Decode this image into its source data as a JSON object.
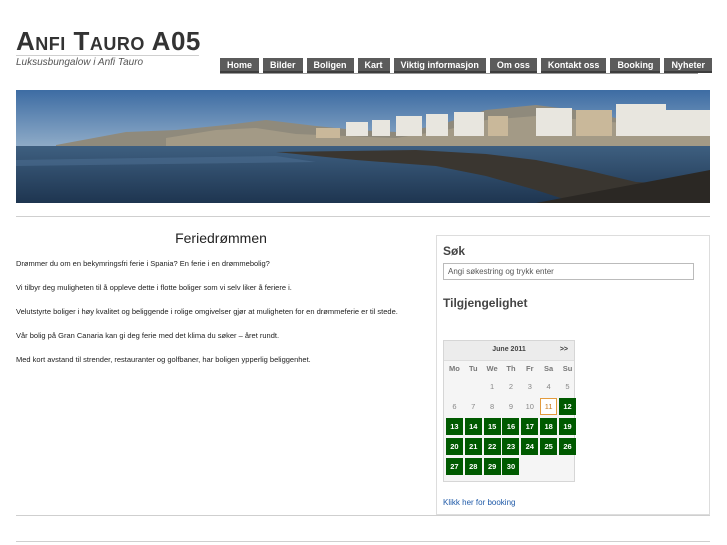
{
  "site": {
    "title_a": "Anfi",
    "title_b": "Tauro",
    "title_c": "A05",
    "subtitle": "Luksusbungalow i Anfi Tauro"
  },
  "nav": [
    "Home",
    "Bilder",
    "Boligen",
    "Kart",
    "Viktig informasjon",
    "Om oss",
    "Kontakt oss",
    "Booking",
    "Nyheter"
  ],
  "main": {
    "heading": "Feriedrømmen",
    "paragraphs": [
      "Drømmer du om en bekymringsfri ferie i Spania? En ferie i en drømmebolig?",
      "Vi tilbyr deg muligheten til å oppleve dette i flotte boliger som vi selv liker å feriere i.",
      "Velutstyrte boliger i høy kvalitet og beliggende i rolige omgivelser gjør at muligheten for en drømmeferie er til stede.",
      "Vår bolig på Gran Canaria kan gi deg ferie med det klima du søker – året rundt.",
      "Med kort avstand til strender, restauranter og golfbaner, har boligen ypperlig beliggenhet."
    ]
  },
  "sidebar": {
    "search_title": "Søk",
    "search_placeholder": "Angi søkestring og trykk enter",
    "availability_title": "Tilgjengelighet",
    "booking_link": "Klikk her for booking"
  },
  "calendar": {
    "month": "June 2011",
    "next": ">>",
    "weekdays": [
      "Mo",
      "Tu",
      "We",
      "Th",
      "Fr",
      "Sa",
      "Su"
    ],
    "leading_blanks": 2,
    "days_in_month": 30,
    "today": 11,
    "available_from": 12,
    "available_color": "#005a00",
    "today_border_color": "#e39b3c"
  },
  "banner": {
    "icon": "coastal-town-panorama"
  }
}
